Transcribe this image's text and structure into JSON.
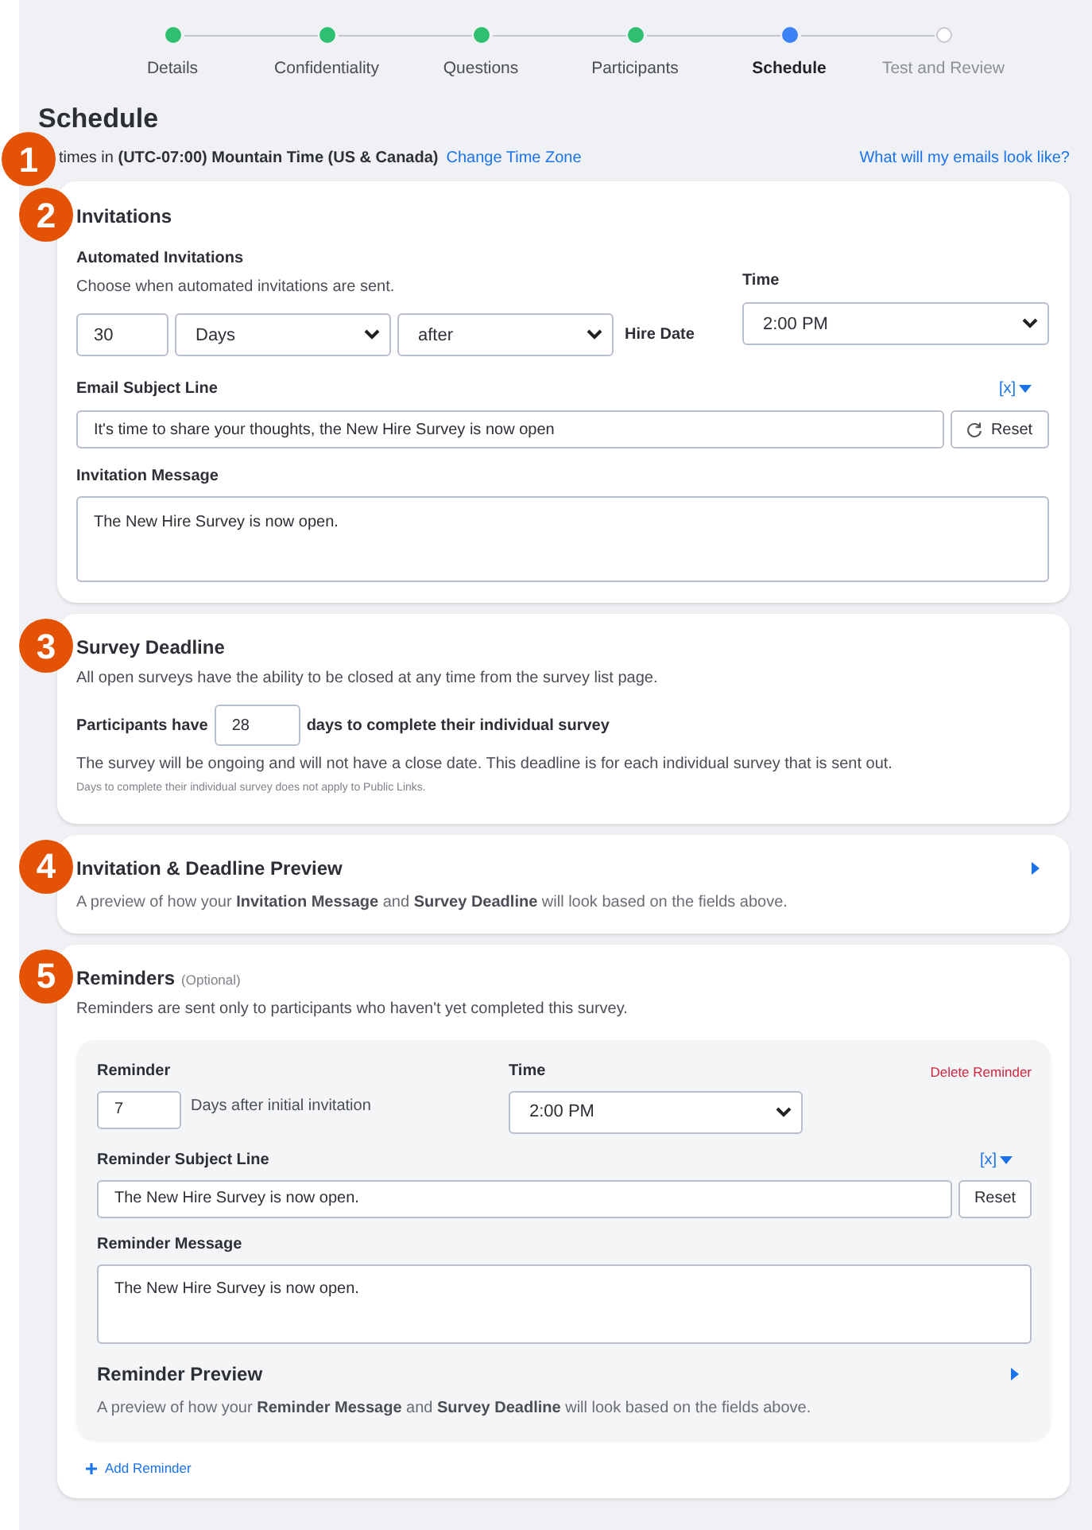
{
  "steps": [
    {
      "label": "Details",
      "completed": true,
      "selected": false
    },
    {
      "label": "Confidentiality",
      "completed": true,
      "selected": false
    },
    {
      "label": "Questions",
      "completed": true,
      "selected": false
    },
    {
      "label": "Participants",
      "completed": true,
      "selected": false
    },
    {
      "label": "Schedule",
      "completed": false,
      "selected": true
    },
    {
      "label": "Test and Review",
      "completed": false,
      "selected": false
    }
  ],
  "page_title": "Schedule",
  "timezone": {
    "callout": "1",
    "text": "times in **(UTC-07:00) Mountain Time (US & Canada)**",
    "link": "Change Time Zone"
  },
  "email_preview_link": "What will my emails look like?",
  "invitations": {
    "callout": "2",
    "title": "Invitations",
    "subtitle": "Automated Invitations",
    "hint": "Choose when automated invitations are sent.",
    "amount": "30",
    "unit": "Days",
    "relation": "after",
    "anchor": "Hire Date",
    "time_label": "Time",
    "time": "2:00 PM",
    "subject_label": "Email Subject Line",
    "variable_menu": "[x]",
    "subject": "It's time to share your thoughts, the New Hire Survey is now open",
    "reset": "Reset",
    "message_label": "Invitation Message",
    "message": "The New Hire Survey is now open."
  },
  "deadline": {
    "callout": "3",
    "title": "Survey Deadline",
    "hint": "All open surveys have the ability to be closed at any time from the survey list page.",
    "before": "Participants have",
    "days": "28",
    "after": "days to complete their individual survey",
    "note": "The survey will be ongoing and will not have a close date. This deadline is for each individual survey that is sent out.",
    "small_note": "Days to complete their individual survey does not apply to Public Links."
  },
  "preview": {
    "callout": "4",
    "title": "Invitation & Deadline Preview",
    "text": "A preview of how your **Invitation Message** and **Survey Deadline** will look based on the fields above.",
    "expanded": false
  },
  "reminders": {
    "callout": "5",
    "title": "Reminders",
    "optional": "(Optional)",
    "hint": "Reminders are sent only to participants who haven't yet completed this survey.",
    "items": [
      {
        "label": "Reminder",
        "days": "7",
        "days_text": "Days after initial invitation",
        "time_label": "Time",
        "time": "2:00 PM",
        "delete": "Delete Reminder",
        "subject_label": "Reminder Subject Line",
        "variable_menu": "[x]",
        "subject": "The New Hire Survey is now open.",
        "reset": "Reset",
        "message_label": "Reminder Message",
        "message": "The New Hire Survey is now open.",
        "preview_title": "Reminder Preview",
        "preview_text": "A preview of how your **Reminder Message** and **Survey Deadline** will look based on the fields above.",
        "preview_expanded": false
      }
    ],
    "add": "Add Reminder"
  }
}
